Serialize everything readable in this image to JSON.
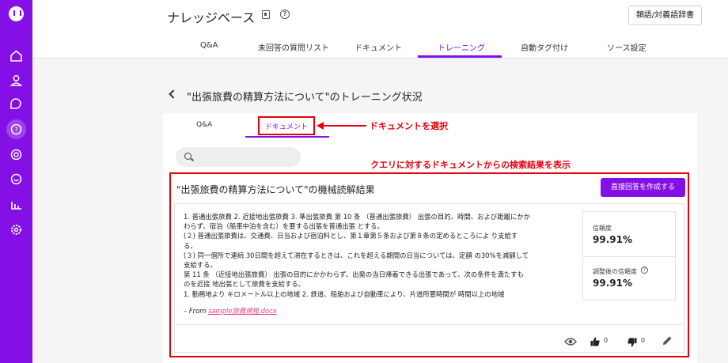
{
  "header": {
    "title": "ナレッジベース",
    "dict_button": "類語/対義語辞書",
    "tabs": [
      "Q&A",
      "未回答の質問リスト",
      "ドキュメント",
      "トレーニング",
      "自動タグ付け",
      "ソース設定"
    ]
  },
  "page": {
    "title": "\"出張旅費の精算方法について\"のトレーニング状況"
  },
  "subtabs": [
    "Q&A",
    "ドキュメント"
  ],
  "annotations": {
    "select_document": "ドキュメントを選択",
    "search_results": "クエリに対するドキュメントからの検索結果を表示"
  },
  "result": {
    "title": "\"出張旅費の精算方法について\"の機械読解結果",
    "direct_answer_button": "直接回答を作成する",
    "text_lines": [
      "1. 普通出張旅費 2. 近接地出張旅費 3. 準出張旅費 第 10 条 （普通出張旅費） 出張の目的、時間、および距離にかか",
      "わらず、宿泊（船車中泊を含む）を要する出張を普通出張 とする。",
      "(２) 普通出張旅費は、交通費、日当および宿泊料とし、第１章第５条および第８条の定めるところによ り支給す",
      "る。",
      "(３) 同一個所で連続 30日間を超えて滞在するときは、これを超える期間の日当については、定額 の30%を減額して",
      "支給する。",
      "第 11 条 （近接地出張旅費） 出張の目的にかかわらず、出発の当日帰着できる出張であって、次の条件を満たすも",
      "のを近接 地出張として旅費を支給する。",
      "1. 勤務地より キロメートル以上の地域 2. 鉄道、船舶および自動車により、片道所要時間が 時間以上の地域"
    ],
    "source_prefix": "– From ",
    "source_file": "sample旅費規程.docx",
    "confidence_label": "信頼度",
    "confidence_value": "99.91%",
    "adjusted_confidence_label": "調整後の信頼度",
    "adjusted_confidence_value": "99.91%",
    "likes": "0",
    "dislikes": "0"
  },
  "colors": {
    "brand": "#8410e6",
    "annotation": "#e8000c",
    "link": "#e8447a"
  }
}
